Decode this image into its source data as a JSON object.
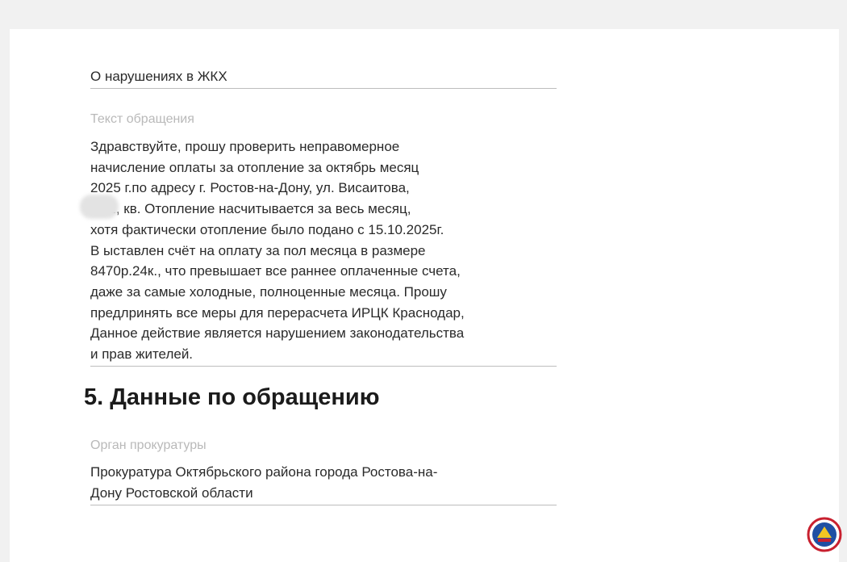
{
  "topic": {
    "value": "О нарушениях в ЖКХ"
  },
  "appeal_text": {
    "label": "Текст обращения",
    "lines": [
      "Здравствуйте, прошу проверить неправомерное",
      "начисление оплаты за отопление за октябрь месяц",
      "2025 г.по адресу г. Ростов-на-Дону, ул. Висаитова,",
      "5/11, кв.      Отопление насчитывается за весь месяц,",
      "хотя фактически отопление было подано с 15.10.2025г.",
      "В ыставлен счёт на оплату за пол месяца в размере",
      "8470р.24к., что превышает все раннее оплаченные счета,",
      "даже за самые холодные, полноценные месяца. Прошу",
      "предлринять все меры для перерасчета ИРЦК Краснодар,",
      "Данное действие является нарушением законодательства",
      "и прав жителей."
    ]
  },
  "section5": {
    "title": "5. Данные по обращению"
  },
  "prosecutor": {
    "label": "Орган прокуратуры",
    "lines": [
      "Прокуратура Октябрьского района города Ростова-на-",
      "Дону Ростовской области"
    ]
  },
  "colors": {
    "page_bg": "#f1f1f1",
    "card_bg": "#ffffff",
    "label": "#b9b9b9",
    "text": "#2a2a2a",
    "divider": "#bdbdbd"
  },
  "icons": {
    "corner_logo": "newspaper-logo-icon"
  }
}
